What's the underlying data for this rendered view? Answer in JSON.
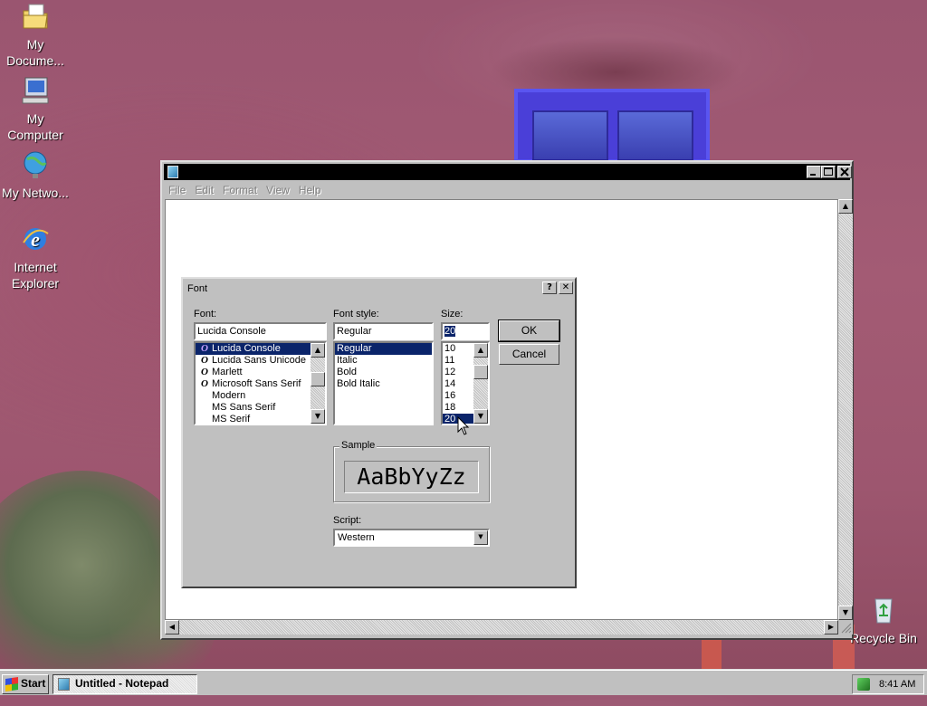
{
  "desktop": {
    "icons": [
      {
        "label": "My Docume...",
        "icon": "my-documents-icon"
      },
      {
        "label": "My Computer",
        "icon": "my-computer-icon"
      },
      {
        "label": "My Netwo...",
        "icon": "my-network-icon"
      },
      {
        "label": "Internet Explorer",
        "icon": "internet-explorer-icon"
      },
      {
        "label": "Recycle Bin",
        "icon": "recycle-bin-icon"
      }
    ]
  },
  "notepad": {
    "title": "",
    "menu": [
      "File",
      "Edit",
      "Format",
      "View",
      "Help"
    ],
    "content": ""
  },
  "font_dialog": {
    "title": "Font",
    "help_button": "?",
    "close_button": "✕",
    "font_label": "Font:",
    "font_value": "Lucida Console",
    "font_list": [
      "Lucida Console",
      "Lucida Sans Unicode",
      "Marlett",
      "Microsoft Sans Serif",
      "Modern",
      "MS Sans Serif",
      "MS Serif"
    ],
    "font_selected": "Lucida Console",
    "style_label": "Font style:",
    "style_value": "Regular",
    "style_list": [
      "Regular",
      "Italic",
      "Bold",
      "Bold Italic"
    ],
    "style_selected": "Regular",
    "size_label": "Size:",
    "size_value": "20",
    "size_list": [
      "10",
      "11",
      "12",
      "14",
      "16",
      "18",
      "20"
    ],
    "size_selected": "20",
    "ok_label": "OK",
    "cancel_label": "Cancel",
    "sample_label": "Sample",
    "sample_text": "AaBbYyZz",
    "script_label": "Script:",
    "script_value": "Western"
  },
  "taskbar": {
    "start_label": "Start",
    "task_label": "Untitled - Notepad",
    "clock": "8:41 AM"
  },
  "colors": {
    "selection": "#0a246a",
    "face": "#c0c0c0",
    "title_bar": "#000000"
  }
}
